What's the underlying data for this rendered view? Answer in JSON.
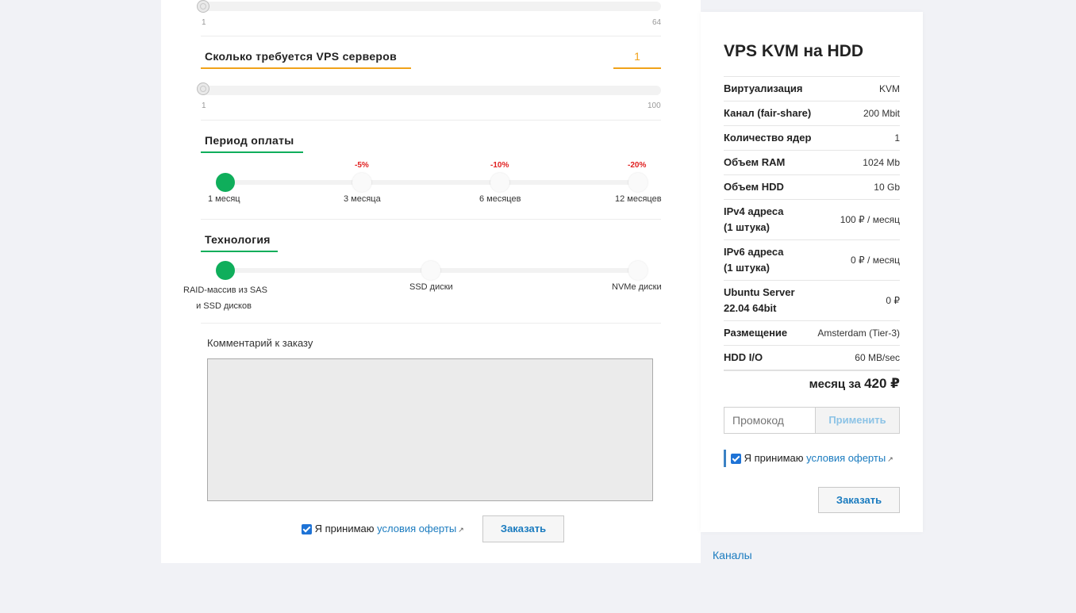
{
  "cores_slider": {
    "min_label": "1",
    "max_label": "64",
    "value": 1
  },
  "servers": {
    "title": "Сколько требуется VPS серверов",
    "value": "1",
    "min_label": "1",
    "max_label": "100"
  },
  "period": {
    "title": "Период оплаты",
    "steps": [
      {
        "label": "1 месяц",
        "discount": "",
        "active": true
      },
      {
        "label": "3 месяца",
        "discount": "-5%",
        "active": false
      },
      {
        "label": "6 месяцев",
        "discount": "-10%",
        "active": false
      },
      {
        "label": "12 месяцев",
        "discount": "-20%",
        "active": false
      }
    ]
  },
  "technology": {
    "title": "Технология",
    "steps": [
      {
        "label_line1": "RAID-массив из SAS",
        "label_line2": "и SSD дисков",
        "active": true
      },
      {
        "label_line1": "SSD диски",
        "label_line2": "",
        "active": false
      },
      {
        "label_line1": "NVMe диски",
        "label_line2": "",
        "active": false
      }
    ]
  },
  "comment": {
    "label": "Комментарий к заказу",
    "value": ""
  },
  "agreement": {
    "prefix": "Я принимаю",
    "link": "условия оферты",
    "checked": true
  },
  "order_button": "Заказать",
  "summary": {
    "title": "VPS KVM на HDD",
    "specs": [
      {
        "key": "Виртуализация",
        "value": "KVM"
      },
      {
        "key": "Канал (fair-share)",
        "value": "200 Mbit"
      },
      {
        "key": "Количество ядер",
        "value": "1"
      },
      {
        "key": "Объем RAM",
        "value": "1024 Mb"
      },
      {
        "key": "Объем HDD",
        "value": "10 Gb"
      },
      {
        "key": "IPv4 адреса",
        "key2": "(1 штука)",
        "value": "100 ₽ / месяц"
      },
      {
        "key": "IPv6 адреса",
        "key2": "(1 штука)",
        "value": "0 ₽ / месяц"
      },
      {
        "key": "Ubuntu Server",
        "key2": "22.04 64bit",
        "value": "0 ₽"
      },
      {
        "key": "Размещение",
        "value": "Amsterdam (Tier-3)"
      },
      {
        "key": "HDD I/O",
        "value": "60 MB/sec"
      }
    ],
    "total_prefix": "месяц за",
    "total_amount": "420 ₽",
    "promo_placeholder": "Промокод",
    "apply_button": "Применить",
    "agree_prefix": "Я принимаю",
    "agree_link": "условия оферты",
    "order_button": "Заказать"
  },
  "channels_link": "Каналы",
  "colors": {
    "accent_green": "#0fae5b",
    "accent_orange": "#f0a21a",
    "link_blue": "#1a7bbf",
    "discount_red": "#e02020"
  }
}
